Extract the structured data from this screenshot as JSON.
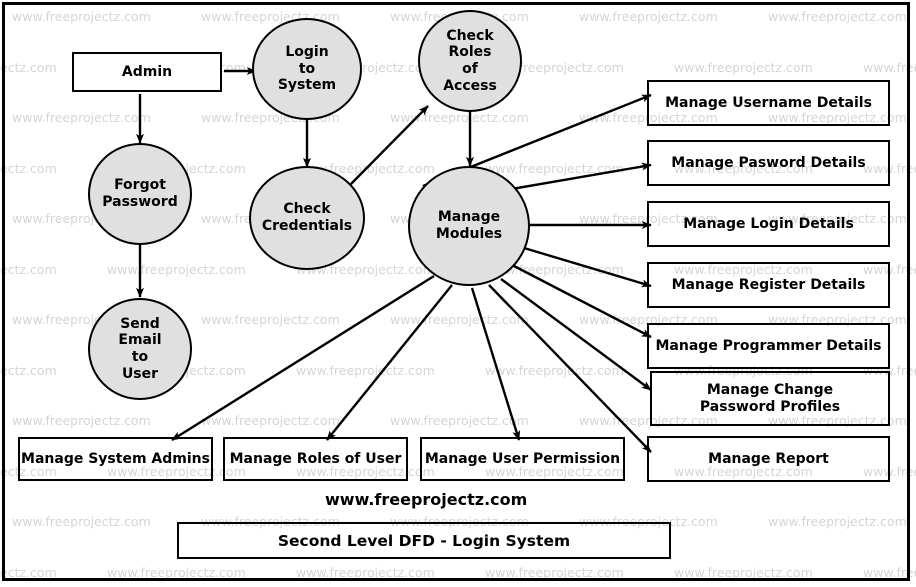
{
  "diagram": {
    "caption": "www.freeprojectz.com",
    "title": "Second Level DFD - Login System",
    "watermark_text": "www.freeprojectz.com",
    "colors": {
      "process_fill": "#e0e0e0",
      "stroke": "#000000",
      "entity_fill": "#ffffff",
      "watermark": "#d5d5d5",
      "background": "#ffffff"
    }
  },
  "entities": [
    {
      "id": "admin",
      "label": "Admin"
    }
  ],
  "processes": [
    {
      "id": "login-to-system",
      "label": "Login\nto\nSystem"
    },
    {
      "id": "check-roles-of-access",
      "label": "Check\nRoles\nof\nAccess"
    },
    {
      "id": "forgot-password",
      "label": "Forgot\nPassword"
    },
    {
      "id": "check-credentials",
      "label": "Check\nCredentials"
    },
    {
      "id": "manage-modules",
      "label": "Manage\nModules"
    },
    {
      "id": "send-email-to-user",
      "label": "Send\nEmail\nto\nUser"
    }
  ],
  "right_stores": [
    {
      "id": "manage-username-details",
      "label": "Manage Username Details"
    },
    {
      "id": "manage-pasword-details",
      "label": "Manage Pasword Details"
    },
    {
      "id": "manage-login-details",
      "label": "Manage Login Details"
    },
    {
      "id": "manage-register-details",
      "label": "Manage Register Details"
    },
    {
      "id": "manage-programmer-details",
      "label": "Manage Programmer Details"
    },
    {
      "id": "manage-change-password-profiles",
      "label": "Manage Change\nPassword Profiles"
    },
    {
      "id": "manage-report",
      "label": "Manage  Report"
    }
  ],
  "bottom_stores": [
    {
      "id": "manage-system-admins",
      "label": "Manage System Admins"
    },
    {
      "id": "manage-roles-of-user",
      "label": "Manage Roles of User"
    },
    {
      "id": "manage-user-permission",
      "label": "Manage User Permission"
    }
  ],
  "flows": [
    {
      "from": "admin",
      "to": "login-to-system"
    },
    {
      "from": "admin",
      "to": "forgot-password"
    },
    {
      "from": "forgot-password",
      "to": "send-email-to-user"
    },
    {
      "from": "login-to-system",
      "to": "check-credentials"
    },
    {
      "from": "check-credentials",
      "to": "check-roles-of-access"
    },
    {
      "from": "check-roles-of-access",
      "to": "manage-modules"
    },
    {
      "from": "manage-modules",
      "to": "manage-username-details"
    },
    {
      "from": "manage-modules",
      "to": "manage-pasword-details"
    },
    {
      "from": "manage-modules",
      "to": "manage-login-details"
    },
    {
      "from": "manage-modules",
      "to": "manage-register-details"
    },
    {
      "from": "manage-modules",
      "to": "manage-programmer-details"
    },
    {
      "from": "manage-modules",
      "to": "manage-change-password-profiles"
    },
    {
      "from": "manage-modules",
      "to": "manage-report"
    },
    {
      "from": "manage-modules",
      "to": "manage-system-admins"
    },
    {
      "from": "manage-modules",
      "to": "manage-roles-of-user"
    },
    {
      "from": "manage-modules",
      "to": "manage-user-permission"
    }
  ]
}
